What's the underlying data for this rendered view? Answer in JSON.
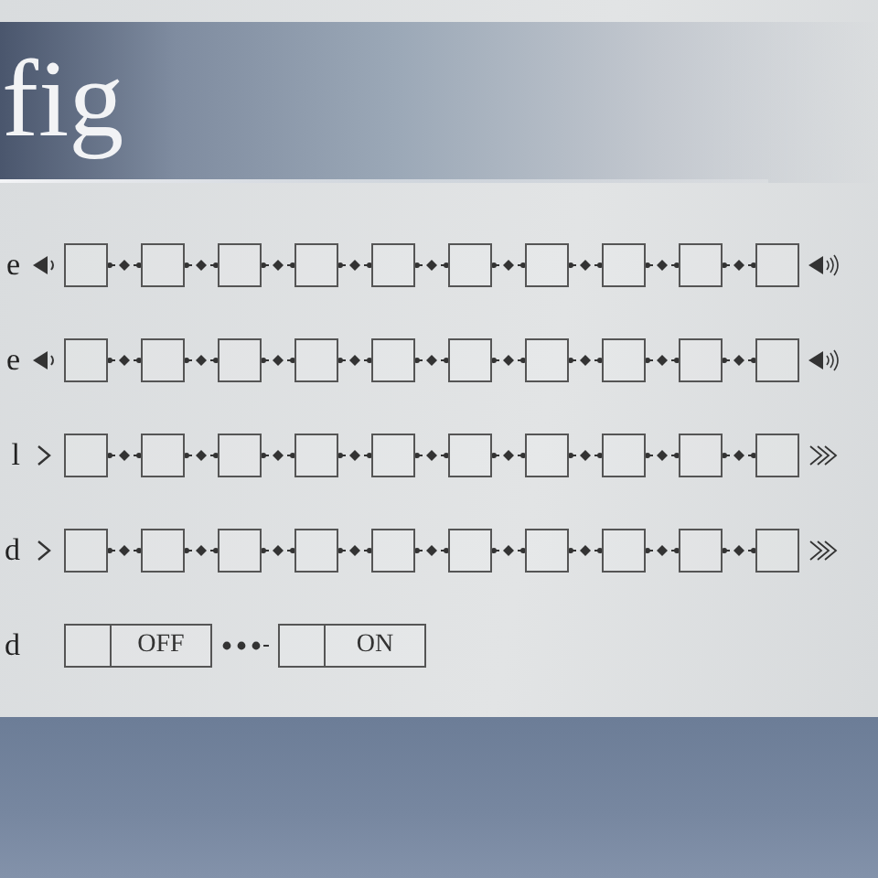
{
  "title": "fig",
  "settings": [
    {
      "label": "e",
      "kind": "volume",
      "level": 0
    },
    {
      "label": "e",
      "kind": "volume",
      "level": 0
    },
    {
      "label": "l",
      "kind": "speed",
      "level": 0
    },
    {
      "label": "d",
      "kind": "speed",
      "level": 0
    },
    {
      "label": "d",
      "kind": "toggle",
      "options": [
        {
          "label": "OFF",
          "selected": false
        },
        {
          "label": "ON",
          "selected": false
        }
      ]
    }
  ]
}
